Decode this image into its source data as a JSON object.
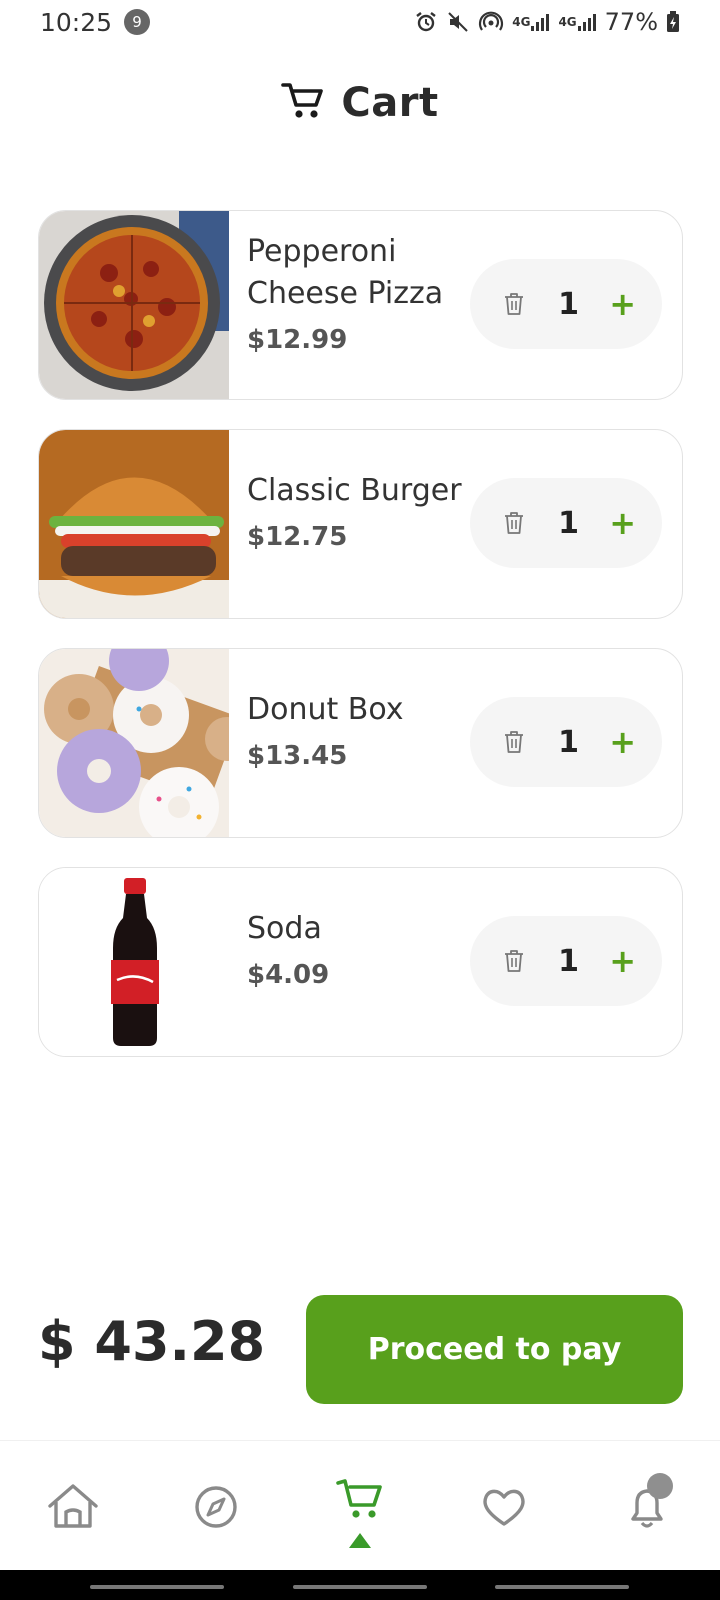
{
  "status_bar": {
    "time": "10:25",
    "notification_count": "9",
    "network_1": "4G",
    "network_2": "4G",
    "battery": "77%"
  },
  "header": {
    "title": "Cart",
    "icon": "cart-icon"
  },
  "cart_items": [
    {
      "name": "Pepperoni Cheese Pizza",
      "price": "$12.99",
      "quantity": "1",
      "image": "pizza"
    },
    {
      "name": "Classic Burger",
      "price": "$12.75",
      "quantity": "1",
      "image": "burger"
    },
    {
      "name": "Donut Box",
      "price": "$13.45",
      "quantity": "1",
      "image": "donuts"
    },
    {
      "name": "Soda",
      "price": "$4.09",
      "quantity": "1",
      "image": "soda-bottle"
    }
  ],
  "controls": {
    "plus_label": "+",
    "delete_icon": "trash-icon"
  },
  "footer": {
    "total": "$ 43.28",
    "pay_label": "Proceed to pay"
  },
  "bottom_nav": {
    "items": [
      "home-icon",
      "compass-icon",
      "cart-icon",
      "heart-icon",
      "bell-icon"
    ],
    "active": "cart-icon"
  },
  "colors": {
    "accent": "#58a01c",
    "pill_background": "#f5f5f5",
    "card_border": "#e2e2e2"
  }
}
